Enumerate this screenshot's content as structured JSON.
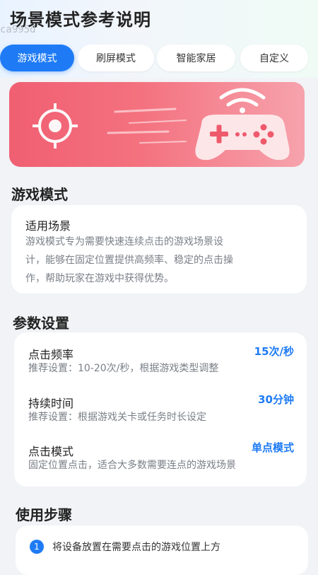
{
  "header": {
    "title": "场景模式参考说明",
    "watermark": "ca995d"
  },
  "tabs": [
    {
      "label": "游戏模式",
      "active": true
    },
    {
      "label": "刷屏模式",
      "active": false
    },
    {
      "label": "智能家居",
      "active": false
    },
    {
      "label": "自定义",
      "active": false
    }
  ],
  "banner": {
    "icons": [
      "crosshair-icon",
      "wifi-signal-icon",
      "gamepad-icon"
    ],
    "colors": {
      "from": "#f05f72",
      "to": "#f6a3ad"
    }
  },
  "mode_section": {
    "title": "游戏模式",
    "card_heading": "适用场景",
    "description_lines": [
      "游戏模式专为需要快速连续点击的游戏场景设",
      "计，能够在固定位置提供高频率、稳定的点击操",
      "作，帮助玩家在游戏中获得优势。"
    ]
  },
  "params_section": {
    "title": "参数设置",
    "items": [
      {
        "name": "点击频率",
        "value": "15次/秒",
        "hint": "推荐设置：10-20次/秒，根据游戏类型调整"
      },
      {
        "name": "持续时间",
        "value": "30分钟",
        "hint": "推荐设置：根据游戏关卡或任务时长设定"
      },
      {
        "name": "点击模式",
        "value": "单点模式",
        "hint": "固定位置点击，适合大多数需要连点的游戏场景"
      }
    ]
  },
  "steps_section": {
    "title": "使用步骤",
    "steps": [
      {
        "number": "1",
        "text": "将设备放置在需要点击的游戏位置上方"
      }
    ]
  },
  "colors": {
    "accent": "#1e7bf5",
    "background": "#f1f3f6"
  }
}
